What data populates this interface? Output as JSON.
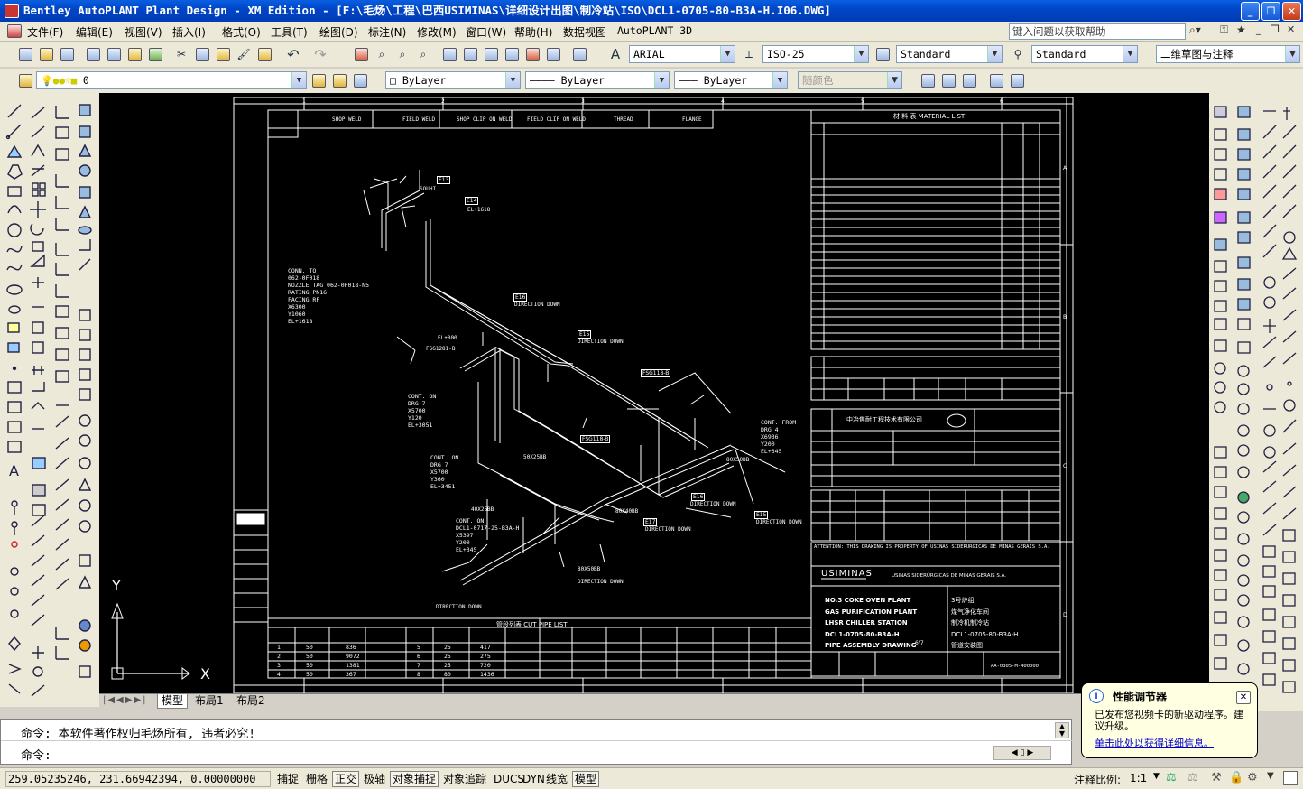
{
  "window": {
    "title": "Bentley AutoPLANT Plant Design - XM Edition - [F:\\毛炀\\工程\\巴西USIMINAS\\详细设计出图\\制冷站\\ISO\\DCL1-0705-80-B3A-H.I06.DWG]",
    "controls": [
      "_",
      "❐",
      "✕"
    ]
  },
  "menu": {
    "items": [
      "文件(F)",
      "编辑(E)",
      "视图(V)",
      "插入(I)",
      "格式(O)",
      "工具(T)",
      "绘图(D)",
      "标注(N)",
      "修改(M)",
      "窗口(W)",
      "帮助(H)",
      "数据视图",
      "AutoPLANT 3D"
    ],
    "help_placeholder": "键入问题以获取帮助"
  },
  "toolbar": {
    "text_style": "ARIAL",
    "dim_style": "ISO-25",
    "table_style": "Standard",
    "multileader_style": "Standard",
    "workspace": "二维草图与注释",
    "layer": "0",
    "color": "ByLayer",
    "linetype": "ByLayer",
    "lineweight": "ByLayer",
    "plotstyle": "随颜色"
  },
  "drawing": {
    "legend": [
      "SHOP WELD",
      "FIELD WELD",
      "SHOP CLIP ON WELD",
      "FIELD CLIP ON WELD",
      "THREAD",
      "FLANGE"
    ],
    "material_list_title": "材 料 表       MATERIAL LIST",
    "zones_top": [
      "1",
      "2",
      "3",
      "4",
      "5",
      "6"
    ],
    "zones_right": [
      "A",
      "B",
      "C",
      "D"
    ],
    "conn_to": [
      "CONN. TO",
      "062-0F018",
      "NOZZLE TAG 062-0F018-N5",
      "RATING PN16",
      "FACING RF",
      "X6300",
      "Y1060",
      "EL+1618"
    ],
    "cont_on_1": [
      "CONT. ON",
      "DRG 7",
      "X5700",
      "Y120",
      "EL+3051"
    ],
    "cont_on_2": [
      "CONT. ON",
      "DRG 7",
      "X5700",
      "Y360",
      "EL+3451"
    ],
    "cont_on_3": [
      "CONT. ON",
      "DCL1-0717-25-B3A-H",
      "X5397",
      "Y200",
      "EL+345"
    ],
    "cont_from": [
      "CONT. FROM",
      "DRG 4",
      "X6936",
      "Y200",
      "EL+345"
    ],
    "labels": [
      "DIRECTION DOWN",
      "DIRECTION DOWN",
      "DIRECTION DOWN",
      "DIRECTION DOWN",
      "DIRECTION DOWN",
      "DIRECTION DOWN",
      "DIRECTION DOWN"
    ],
    "weld_tags": [
      "E16",
      "E15",
      "E17",
      "E15",
      "E16",
      "E13",
      "E14"
    ],
    "misc_labels": [
      "EL+1618",
      "EL+800",
      "EL+345",
      "SOUHI",
      "FSG1281-B",
      "FSG118-B",
      "FSG118-B",
      "50X25BB",
      "80X50BB",
      "80X50BB",
      "80X40BB",
      "40X25BB",
      "DN 1000",
      "DN 400"
    ],
    "title_block": {
      "company_cn": "中冶焦耐工程技术有限公司",
      "usiminas": "USIMINAS",
      "usiminas_full": "USINAS SIDERÚRGICAS DE MINAS GERAIS S.A.",
      "plant_lines_en": [
        "NO.3 COKE OVEN PLANT",
        "GAS PURIFICATION PLANT",
        "LHSR CHILLER STATION",
        "DCL1-0705-80-B3A-H",
        "PIPE ASSEMBLY DRAWING"
      ],
      "plant_lines_cn": [
        "3号炉组",
        "煤气净化车间",
        "制冷机制冷站",
        "DCL1-0705-80-B3A-H",
        "管道安装图"
      ],
      "sheet": "6/7",
      "attention": "ATTENTION: THIS DRAWING IS PROPERTY OF USINAS SIDERURGICAS DE MINAS GERAIS S.A.",
      "drg_no": "AA-0305-M-400000"
    },
    "cut_list_title": "管段列表          CUT PIPE LIST",
    "cut_list": [
      [
        "1",
        "50",
        "836"
      ],
      [
        "2",
        "50",
        "9072"
      ],
      [
        "3",
        "50",
        "1381"
      ],
      [
        "4",
        "50",
        "367"
      ],
      [
        "5",
        "25",
        "417"
      ],
      [
        "6",
        "25",
        "275"
      ],
      [
        "7",
        "25",
        "720"
      ],
      [
        "8",
        "80",
        "1436"
      ]
    ]
  },
  "tabs": [
    "模型",
    "布局1",
    "布局2"
  ],
  "command": {
    "line1": "命令: 本软件著作权归毛炀所有, 违者必究!",
    "line2": "命令:"
  },
  "status": {
    "coords": "259.05235246, 231.66942394, 0.00000000",
    "toggles": [
      "捕捉",
      "栅格",
      "正交",
      "极轴",
      "对象捕捉",
      "对象追踪",
      "DUCS",
      "DYN",
      "线宽",
      "模型"
    ],
    "active_toggles": [
      "正交",
      "对象捕捉",
      "模型"
    ],
    "annotation_scale_label": "注释比例:",
    "annotation_scale": "1:1"
  },
  "balloon": {
    "title": "性能调节器",
    "body": "已发布您视频卡的新驱动程序。建议升级。",
    "link": "单击此处以获得详细信息。"
  },
  "ucs": {
    "x": "X",
    "y": "Y"
  }
}
